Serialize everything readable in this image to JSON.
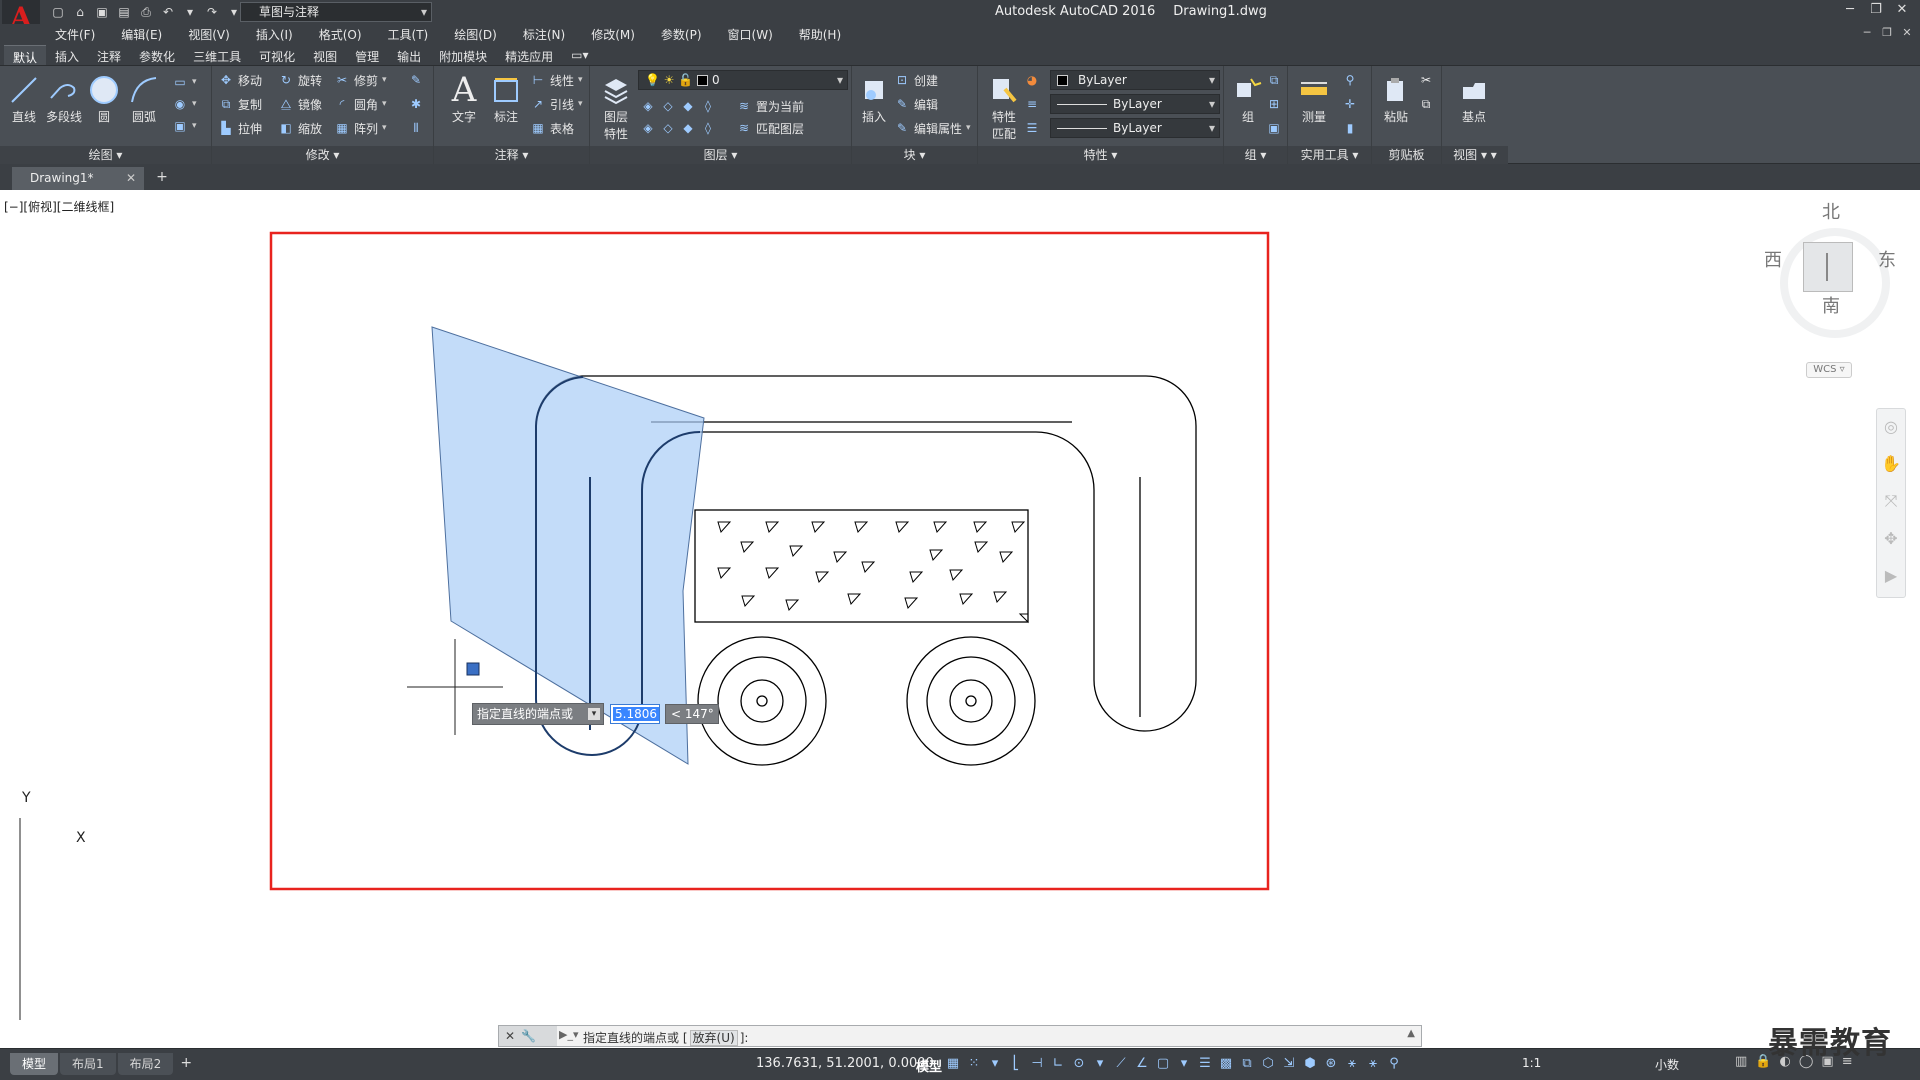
{
  "title_bar": {
    "app_name": "Autodesk AutoCAD 2016",
    "file_name": "Drawing1.dwg",
    "workspace": "草图与注释"
  },
  "menu": [
    "文件(F)",
    "编辑(E)",
    "视图(V)",
    "插入(I)",
    "格式(O)",
    "工具(T)",
    "绘图(D)",
    "标注(N)",
    "修改(M)",
    "参数(P)",
    "窗口(W)",
    "帮助(H)"
  ],
  "ribbon_tabs": [
    "默认",
    "插入",
    "注释",
    "参数化",
    "三维工具",
    "可视化",
    "视图",
    "管理",
    "输出",
    "附加模块",
    "精选应用"
  ],
  "ribbon": {
    "draw": {
      "title": "绘图",
      "line": "直线",
      "polyline": "多段线",
      "circle": "圆",
      "arc": "圆弧"
    },
    "modify": {
      "title": "修改",
      "move": "移动",
      "rotate": "旋转",
      "trim": "修剪",
      "copy": "复制",
      "mirror": "镜像",
      "fillet": "圆角",
      "stretch": "拉伸",
      "scale": "缩放",
      "array": "阵列"
    },
    "annotation": {
      "title": "注释",
      "text": "文字",
      "dimension": "标注",
      "linear": "线性",
      "leader": "引线",
      "table": "表格"
    },
    "layers": {
      "title": "图层",
      "layer_props_1": "图层",
      "layer_props_2": "特性",
      "current_layer": "0",
      "set_current": "置为当前",
      "match_layer": "匹配图层"
    },
    "block": {
      "title": "块",
      "insert": "插入",
      "create": "创建",
      "edit": "编辑",
      "edit_attr": "编辑属性"
    },
    "properties": {
      "title": "特性",
      "match_1": "特性",
      "match_2": "匹配",
      "color": "ByLayer",
      "linetype": "ByLayer",
      "lineweight": "ByLayer"
    },
    "groups": {
      "title": "组",
      "group": "组"
    },
    "utilities": {
      "title": "实用工具",
      "measure": "测量"
    },
    "clipboard": {
      "title": "剪贴板",
      "paste": "粘贴"
    },
    "view": {
      "title": "视图",
      "base": "基点"
    }
  },
  "file_tab": "Drawing1*",
  "viewport_label": "[−][俯视][二维线框]",
  "viewcube": {
    "north": "北",
    "south": "南",
    "east": "东",
    "west": "西",
    "wcs": "WCS"
  },
  "ucs": {
    "x": "X",
    "y": "Y"
  },
  "dynamic_input": {
    "prompt": "指定直线的端点或",
    "length": "5.1806",
    "angle": "< 147°"
  },
  "command_line": {
    "text": "指定直线的端点或",
    "option": "放弃(U)",
    "suffix": "]:",
    "bracket": "["
  },
  "status_bar": {
    "layout_tabs": [
      "模型",
      "布局1",
      "布局2"
    ],
    "coords": "136.7631, 51.2001, 0.0000",
    "model": "模型",
    "scale": "1:1",
    "units": "小数"
  },
  "watermark": "暴需教育",
  "colors": {
    "frame_red": "#e8231e",
    "selection_fill": "#a9cdf7",
    "ui_dark": "#3b3f44",
    "ribbon": "#4a4f55"
  }
}
